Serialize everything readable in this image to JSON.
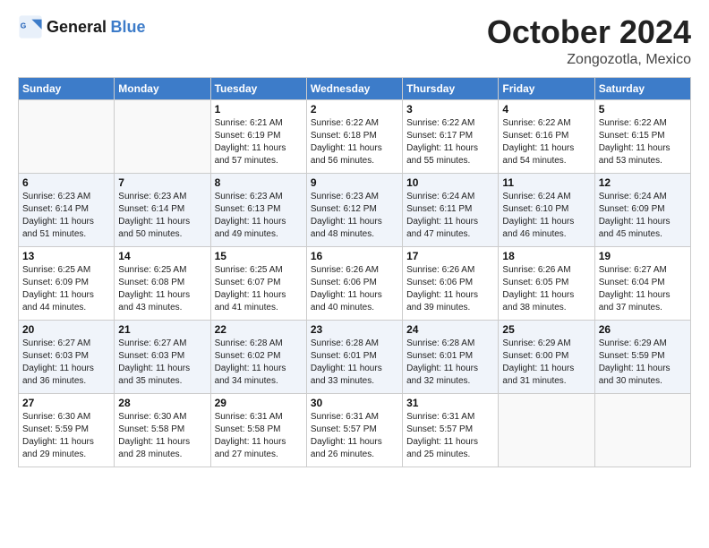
{
  "header": {
    "logo_line1": "General",
    "logo_line2": "Blue",
    "month": "October 2024",
    "location": "Zongozotla, Mexico"
  },
  "days_of_week": [
    "Sunday",
    "Monday",
    "Tuesday",
    "Wednesday",
    "Thursday",
    "Friday",
    "Saturday"
  ],
  "weeks": [
    [
      {
        "day": "",
        "sunrise": "",
        "sunset": "",
        "daylight": ""
      },
      {
        "day": "",
        "sunrise": "",
        "sunset": "",
        "daylight": ""
      },
      {
        "day": "1",
        "sunrise": "Sunrise: 6:21 AM",
        "sunset": "Sunset: 6:19 PM",
        "daylight": "Daylight: 11 hours and 57 minutes."
      },
      {
        "day": "2",
        "sunrise": "Sunrise: 6:22 AM",
        "sunset": "Sunset: 6:18 PM",
        "daylight": "Daylight: 11 hours and 56 minutes."
      },
      {
        "day": "3",
        "sunrise": "Sunrise: 6:22 AM",
        "sunset": "Sunset: 6:17 PM",
        "daylight": "Daylight: 11 hours and 55 minutes."
      },
      {
        "day": "4",
        "sunrise": "Sunrise: 6:22 AM",
        "sunset": "Sunset: 6:16 PM",
        "daylight": "Daylight: 11 hours and 54 minutes."
      },
      {
        "day": "5",
        "sunrise": "Sunrise: 6:22 AM",
        "sunset": "Sunset: 6:15 PM",
        "daylight": "Daylight: 11 hours and 53 minutes."
      }
    ],
    [
      {
        "day": "6",
        "sunrise": "Sunrise: 6:23 AM",
        "sunset": "Sunset: 6:14 PM",
        "daylight": "Daylight: 11 hours and 51 minutes."
      },
      {
        "day": "7",
        "sunrise": "Sunrise: 6:23 AM",
        "sunset": "Sunset: 6:14 PM",
        "daylight": "Daylight: 11 hours and 50 minutes."
      },
      {
        "day": "8",
        "sunrise": "Sunrise: 6:23 AM",
        "sunset": "Sunset: 6:13 PM",
        "daylight": "Daylight: 11 hours and 49 minutes."
      },
      {
        "day": "9",
        "sunrise": "Sunrise: 6:23 AM",
        "sunset": "Sunset: 6:12 PM",
        "daylight": "Daylight: 11 hours and 48 minutes."
      },
      {
        "day": "10",
        "sunrise": "Sunrise: 6:24 AM",
        "sunset": "Sunset: 6:11 PM",
        "daylight": "Daylight: 11 hours and 47 minutes."
      },
      {
        "day": "11",
        "sunrise": "Sunrise: 6:24 AM",
        "sunset": "Sunset: 6:10 PM",
        "daylight": "Daylight: 11 hours and 46 minutes."
      },
      {
        "day": "12",
        "sunrise": "Sunrise: 6:24 AM",
        "sunset": "Sunset: 6:09 PM",
        "daylight": "Daylight: 11 hours and 45 minutes."
      }
    ],
    [
      {
        "day": "13",
        "sunrise": "Sunrise: 6:25 AM",
        "sunset": "Sunset: 6:09 PM",
        "daylight": "Daylight: 11 hours and 44 minutes."
      },
      {
        "day": "14",
        "sunrise": "Sunrise: 6:25 AM",
        "sunset": "Sunset: 6:08 PM",
        "daylight": "Daylight: 11 hours and 43 minutes."
      },
      {
        "day": "15",
        "sunrise": "Sunrise: 6:25 AM",
        "sunset": "Sunset: 6:07 PM",
        "daylight": "Daylight: 11 hours and 41 minutes."
      },
      {
        "day": "16",
        "sunrise": "Sunrise: 6:26 AM",
        "sunset": "Sunset: 6:06 PM",
        "daylight": "Daylight: 11 hours and 40 minutes."
      },
      {
        "day": "17",
        "sunrise": "Sunrise: 6:26 AM",
        "sunset": "Sunset: 6:06 PM",
        "daylight": "Daylight: 11 hours and 39 minutes."
      },
      {
        "day": "18",
        "sunrise": "Sunrise: 6:26 AM",
        "sunset": "Sunset: 6:05 PM",
        "daylight": "Daylight: 11 hours and 38 minutes."
      },
      {
        "day": "19",
        "sunrise": "Sunrise: 6:27 AM",
        "sunset": "Sunset: 6:04 PM",
        "daylight": "Daylight: 11 hours and 37 minutes."
      }
    ],
    [
      {
        "day": "20",
        "sunrise": "Sunrise: 6:27 AM",
        "sunset": "Sunset: 6:03 PM",
        "daylight": "Daylight: 11 hours and 36 minutes."
      },
      {
        "day": "21",
        "sunrise": "Sunrise: 6:27 AM",
        "sunset": "Sunset: 6:03 PM",
        "daylight": "Daylight: 11 hours and 35 minutes."
      },
      {
        "day": "22",
        "sunrise": "Sunrise: 6:28 AM",
        "sunset": "Sunset: 6:02 PM",
        "daylight": "Daylight: 11 hours and 34 minutes."
      },
      {
        "day": "23",
        "sunrise": "Sunrise: 6:28 AM",
        "sunset": "Sunset: 6:01 PM",
        "daylight": "Daylight: 11 hours and 33 minutes."
      },
      {
        "day": "24",
        "sunrise": "Sunrise: 6:28 AM",
        "sunset": "Sunset: 6:01 PM",
        "daylight": "Daylight: 11 hours and 32 minutes."
      },
      {
        "day": "25",
        "sunrise": "Sunrise: 6:29 AM",
        "sunset": "Sunset: 6:00 PM",
        "daylight": "Daylight: 11 hours and 31 minutes."
      },
      {
        "day": "26",
        "sunrise": "Sunrise: 6:29 AM",
        "sunset": "Sunset: 5:59 PM",
        "daylight": "Daylight: 11 hours and 30 minutes."
      }
    ],
    [
      {
        "day": "27",
        "sunrise": "Sunrise: 6:30 AM",
        "sunset": "Sunset: 5:59 PM",
        "daylight": "Daylight: 11 hours and 29 minutes."
      },
      {
        "day": "28",
        "sunrise": "Sunrise: 6:30 AM",
        "sunset": "Sunset: 5:58 PM",
        "daylight": "Daylight: 11 hours and 28 minutes."
      },
      {
        "day": "29",
        "sunrise": "Sunrise: 6:31 AM",
        "sunset": "Sunset: 5:58 PM",
        "daylight": "Daylight: 11 hours and 27 minutes."
      },
      {
        "day": "30",
        "sunrise": "Sunrise: 6:31 AM",
        "sunset": "Sunset: 5:57 PM",
        "daylight": "Daylight: 11 hours and 26 minutes."
      },
      {
        "day": "31",
        "sunrise": "Sunrise: 6:31 AM",
        "sunset": "Sunset: 5:57 PM",
        "daylight": "Daylight: 11 hours and 25 minutes."
      },
      {
        "day": "",
        "sunrise": "",
        "sunset": "",
        "daylight": ""
      },
      {
        "day": "",
        "sunrise": "",
        "sunset": "",
        "daylight": ""
      }
    ]
  ]
}
